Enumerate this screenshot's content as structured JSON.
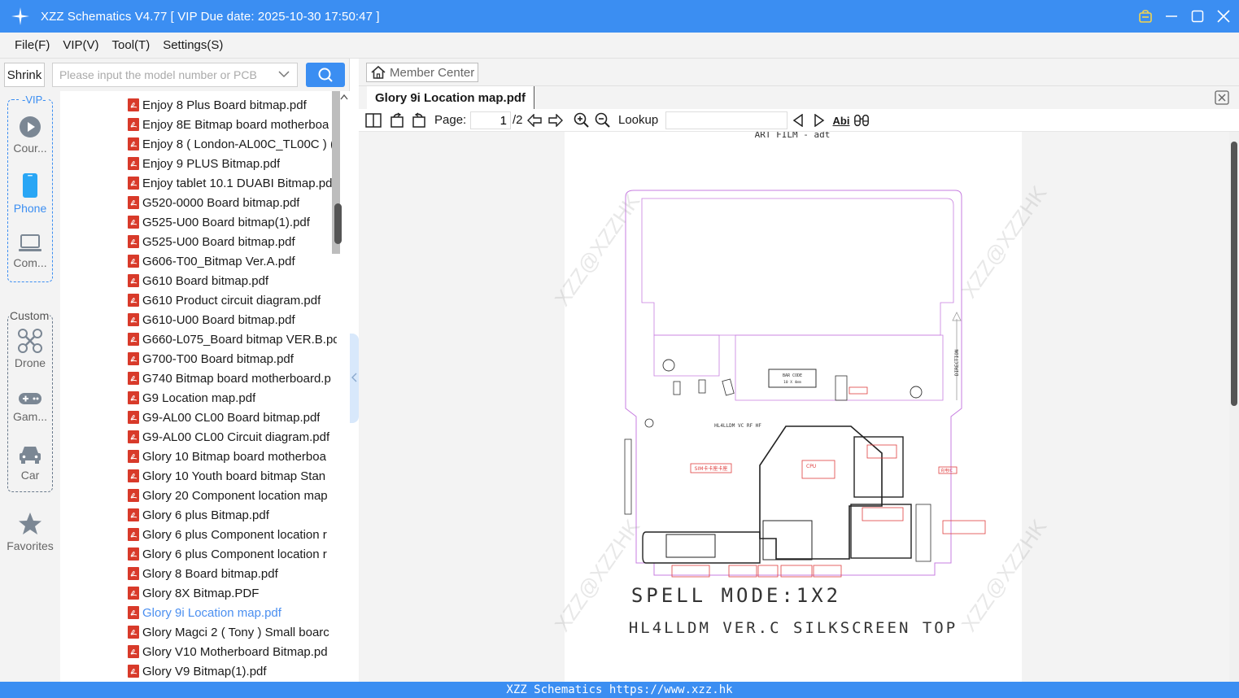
{
  "window": {
    "title": "XZZ Schematics V4.77 [ VIP Due date: 2025-10-30 17:50:47 ]"
  },
  "menu": [
    "File(F)",
    "VIP(V)",
    "Tool(T)",
    "Settings(S)"
  ],
  "search": {
    "shrink_label": "Shrink",
    "placeholder": "Please input the model number or PCB"
  },
  "categories": {
    "vip_label": "-VIP-",
    "custom_label": "Custom",
    "vip_items": [
      {
        "label": "Cour...",
        "icon": "play-circle-icon"
      },
      {
        "label": "Phone",
        "icon": "phone-icon"
      },
      {
        "label": "Com...",
        "icon": "laptop-icon"
      }
    ],
    "custom_items": [
      {
        "label": "Drone",
        "icon": "drone-icon"
      },
      {
        "label": "Gam...",
        "icon": "gamepad-icon"
      },
      {
        "label": "Car",
        "icon": "car-icon"
      }
    ],
    "favorites_label": "Favorites"
  },
  "files": [
    "Enjoy 8 Plus Board bitmap.pdf",
    "Enjoy 8E Bitmap board motherboa",
    "Enjoy 8 ( London-AL00C_TL00C ) (",
    "Enjoy 9 PLUS Bitmap.pdf",
    "Enjoy tablet 10.1 DUABI Bitmap.pd",
    "G520-0000 Board bitmap.pdf",
    "G525-U00 Board bitmap(1).pdf",
    "G525-U00 Board bitmap.pdf",
    "G606-T00_Bitmap Ver.A.pdf",
    "G610 Board bitmap.pdf",
    "G610 Product circuit diagram.pdf",
    "G610-U00 Board bitmap.pdf",
    "G660-L075_Board bitmap VER.B.pd",
    "G700-T00 Board bitmap.pdf",
    "G740 Bitmap board motherboard.p",
    "G9 Location map.pdf",
    "G9-AL00 CL00 Board bitmap.pdf",
    "G9-AL00 CL00 Circuit diagram.pdf",
    "Glory 10 Bitmap board motherboa",
    "Glory 10 Youth board bitmap Stan",
    "Glory 20 Component location map",
    "Glory 6 plus Bitmap.pdf",
    "Glory 6 plus Component location r",
    "Glory 6 plus Component location r",
    "Glory 8 Board bitmap.pdf",
    "Glory 8X Bitmap.PDF",
    "Glory 9i Location map.pdf",
    "Glory Magci 2 ( Tony ) Small boarc",
    "Glory V10 Motherboard Bitmap.pd",
    "Glory V9 Bitmap(1).pdf"
  ],
  "selected_index": 26,
  "viewer": {
    "member_center": "Member Center",
    "tab_title": "Glory 9i Location map.pdf",
    "page_label": "Page:",
    "page_value": "1",
    "page_total": "/2",
    "lookup_label": "Lookup",
    "abi_label": "Abi"
  },
  "document": {
    "header": "ART FILM - adt",
    "bar_code": "BAR CODE",
    "bar_code_size": "10 X 4mm",
    "board_mark": "HL4LLDM VC RF HF",
    "direction": "DIRECTION",
    "spell_mode": "SPELL MODE:1X2",
    "silkscreen": "HL4LLDM VER.C SILKSCREEN TOP",
    "watermark": "XZZ@XZZHK",
    "red_labels": [
      "CPU",
      "SIM卡卡座卡座",
      "充电IC"
    ]
  },
  "status": "XZZ Schematics https://www.xzz.hk"
}
